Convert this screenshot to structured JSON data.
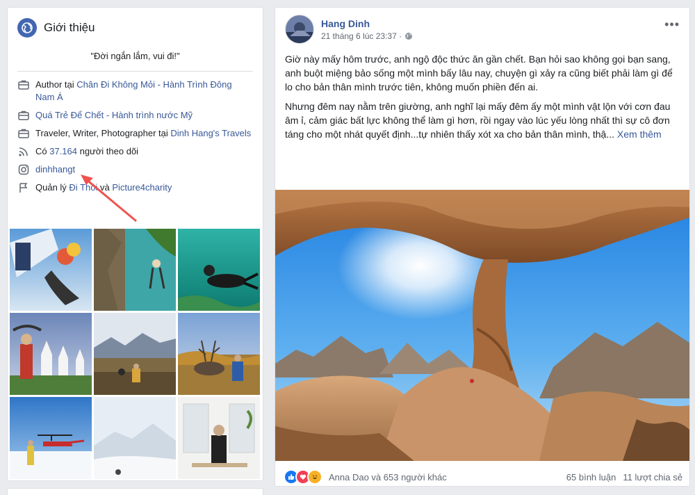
{
  "intro": {
    "title": "Giới thiệu",
    "quote": "\"Đời ngắn lắm, vui đi!\"",
    "rows": [
      {
        "icon": "briefcase-icon",
        "prefix": "Author tại ",
        "link": "Chân Đi Không Mỏi - Hành Trình Đông Nam Á"
      },
      {
        "icon": "briefcase-icon",
        "prefix": "",
        "link": "Quá Trẻ Để Chết - Hành trình nước Mỹ"
      },
      {
        "icon": "briefcase-icon",
        "prefix": "Traveler, Writer, Photographer tại ",
        "link": "Dinh Hang's Travels"
      },
      {
        "icon": "rss-icon",
        "prefix": "Có ",
        "link": "37.164",
        "suffix": " người theo dõi"
      },
      {
        "icon": "instagram-icon",
        "prefix": "",
        "link": "dinhhangt"
      },
      {
        "icon": "flag-icon",
        "prefix": "Quản lý ",
        "link": "Đi Thôi",
        "middle": " và ",
        "link2": "Picture4charity"
      }
    ]
  },
  "post": {
    "author": "Hang Dinh",
    "timestamp": "21 tháng 6 lúc 23:37 ·",
    "more": "•••",
    "paragraph1": "Giờ này mấy hôm trước, anh ngộ độc thức ăn gần chết. Bạn hỏi sao không gọi bạn sang, anh buột miệng bảo sống một mình bấy lâu nay, chuyện gì xảy ra cũng biết phải làm gì để lo cho bản thân mình trước tiên, không muốn phiền đến ai.",
    "paragraph2": "Nhưng đêm nay nằm trên giường, anh nghĩ lại mấy đêm ấy một mình vật lộn với cơn đau âm ỉ, cảm giác bất lực không thể làm gì hơn, rồi ngay vào lúc yếu lòng nhất thì sự cô đơn táng cho một nhát quyết định...tự nhiên thấy xót xa cho bản thân mình, thậ... ",
    "see_more": "Xem thêm",
    "reactions_text": "Anna Dao và 653 người khác",
    "comments": "65 bình luận",
    "shares": "11 lượt chia sẻ"
  },
  "colors": {
    "link": "#385898",
    "brand": "#4267b2",
    "like": "#1877f2",
    "love": "#f33e58",
    "haha": "#f7b125"
  }
}
